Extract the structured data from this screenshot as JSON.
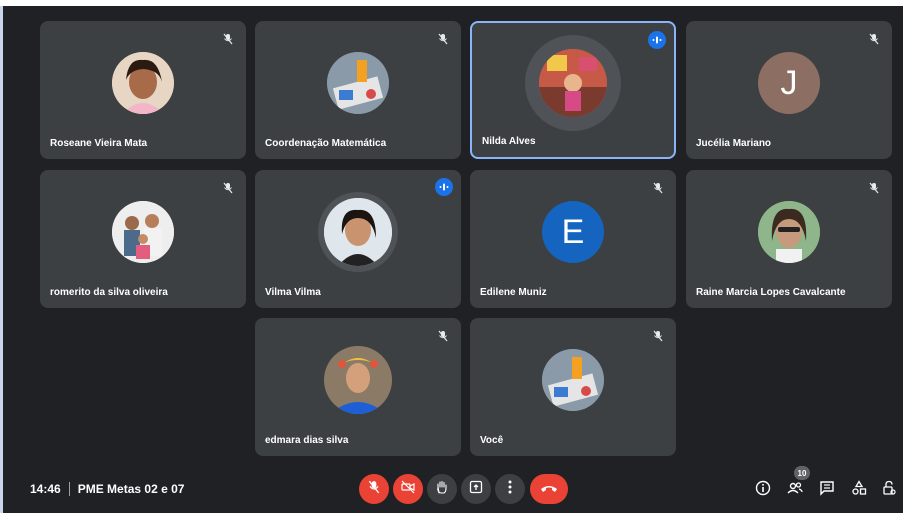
{
  "participants": [
    {
      "name": "Roseane Vieira Mata",
      "mic": "muted"
    },
    {
      "name": "Coordenação Matemática",
      "mic": "muted"
    },
    {
      "name": "Nilda Alves",
      "mic": "speaking"
    },
    {
      "name": "Jucélia Mariano",
      "mic": "muted",
      "initial": "J",
      "avatar_color": "#8d6e63"
    },
    {
      "name": "romerito da silva oliveira",
      "mic": "muted"
    },
    {
      "name": "Vilma Vilma",
      "mic": "speaking"
    },
    {
      "name": "Edilene Muniz",
      "mic": "muted",
      "initial": "E",
      "avatar_color": "#1565c0"
    },
    {
      "name": "Raine Marcia Lopes Cavalcante",
      "mic": "muted"
    },
    {
      "name": "edmara dias silva",
      "mic": "muted"
    },
    {
      "name": "Você",
      "mic": "muted"
    }
  ],
  "meeting": {
    "time": "14:46",
    "title": "PME Metas 02 e 07"
  },
  "controls": [
    "mic-off-icon",
    "camera-off-icon",
    "raise-hand-icon",
    "present-icon",
    "more-options-icon",
    "end-call-icon"
  ],
  "right_panel": {
    "people_count": "10",
    "icons": [
      "info-icon",
      "people-icon",
      "chat-icon",
      "activities-icon",
      "host-controls-icon"
    ]
  },
  "colors": {
    "background": "#202124",
    "tile": "#3c4043",
    "end_call": "#ea4335",
    "speaking": "#1a73e8"
  }
}
